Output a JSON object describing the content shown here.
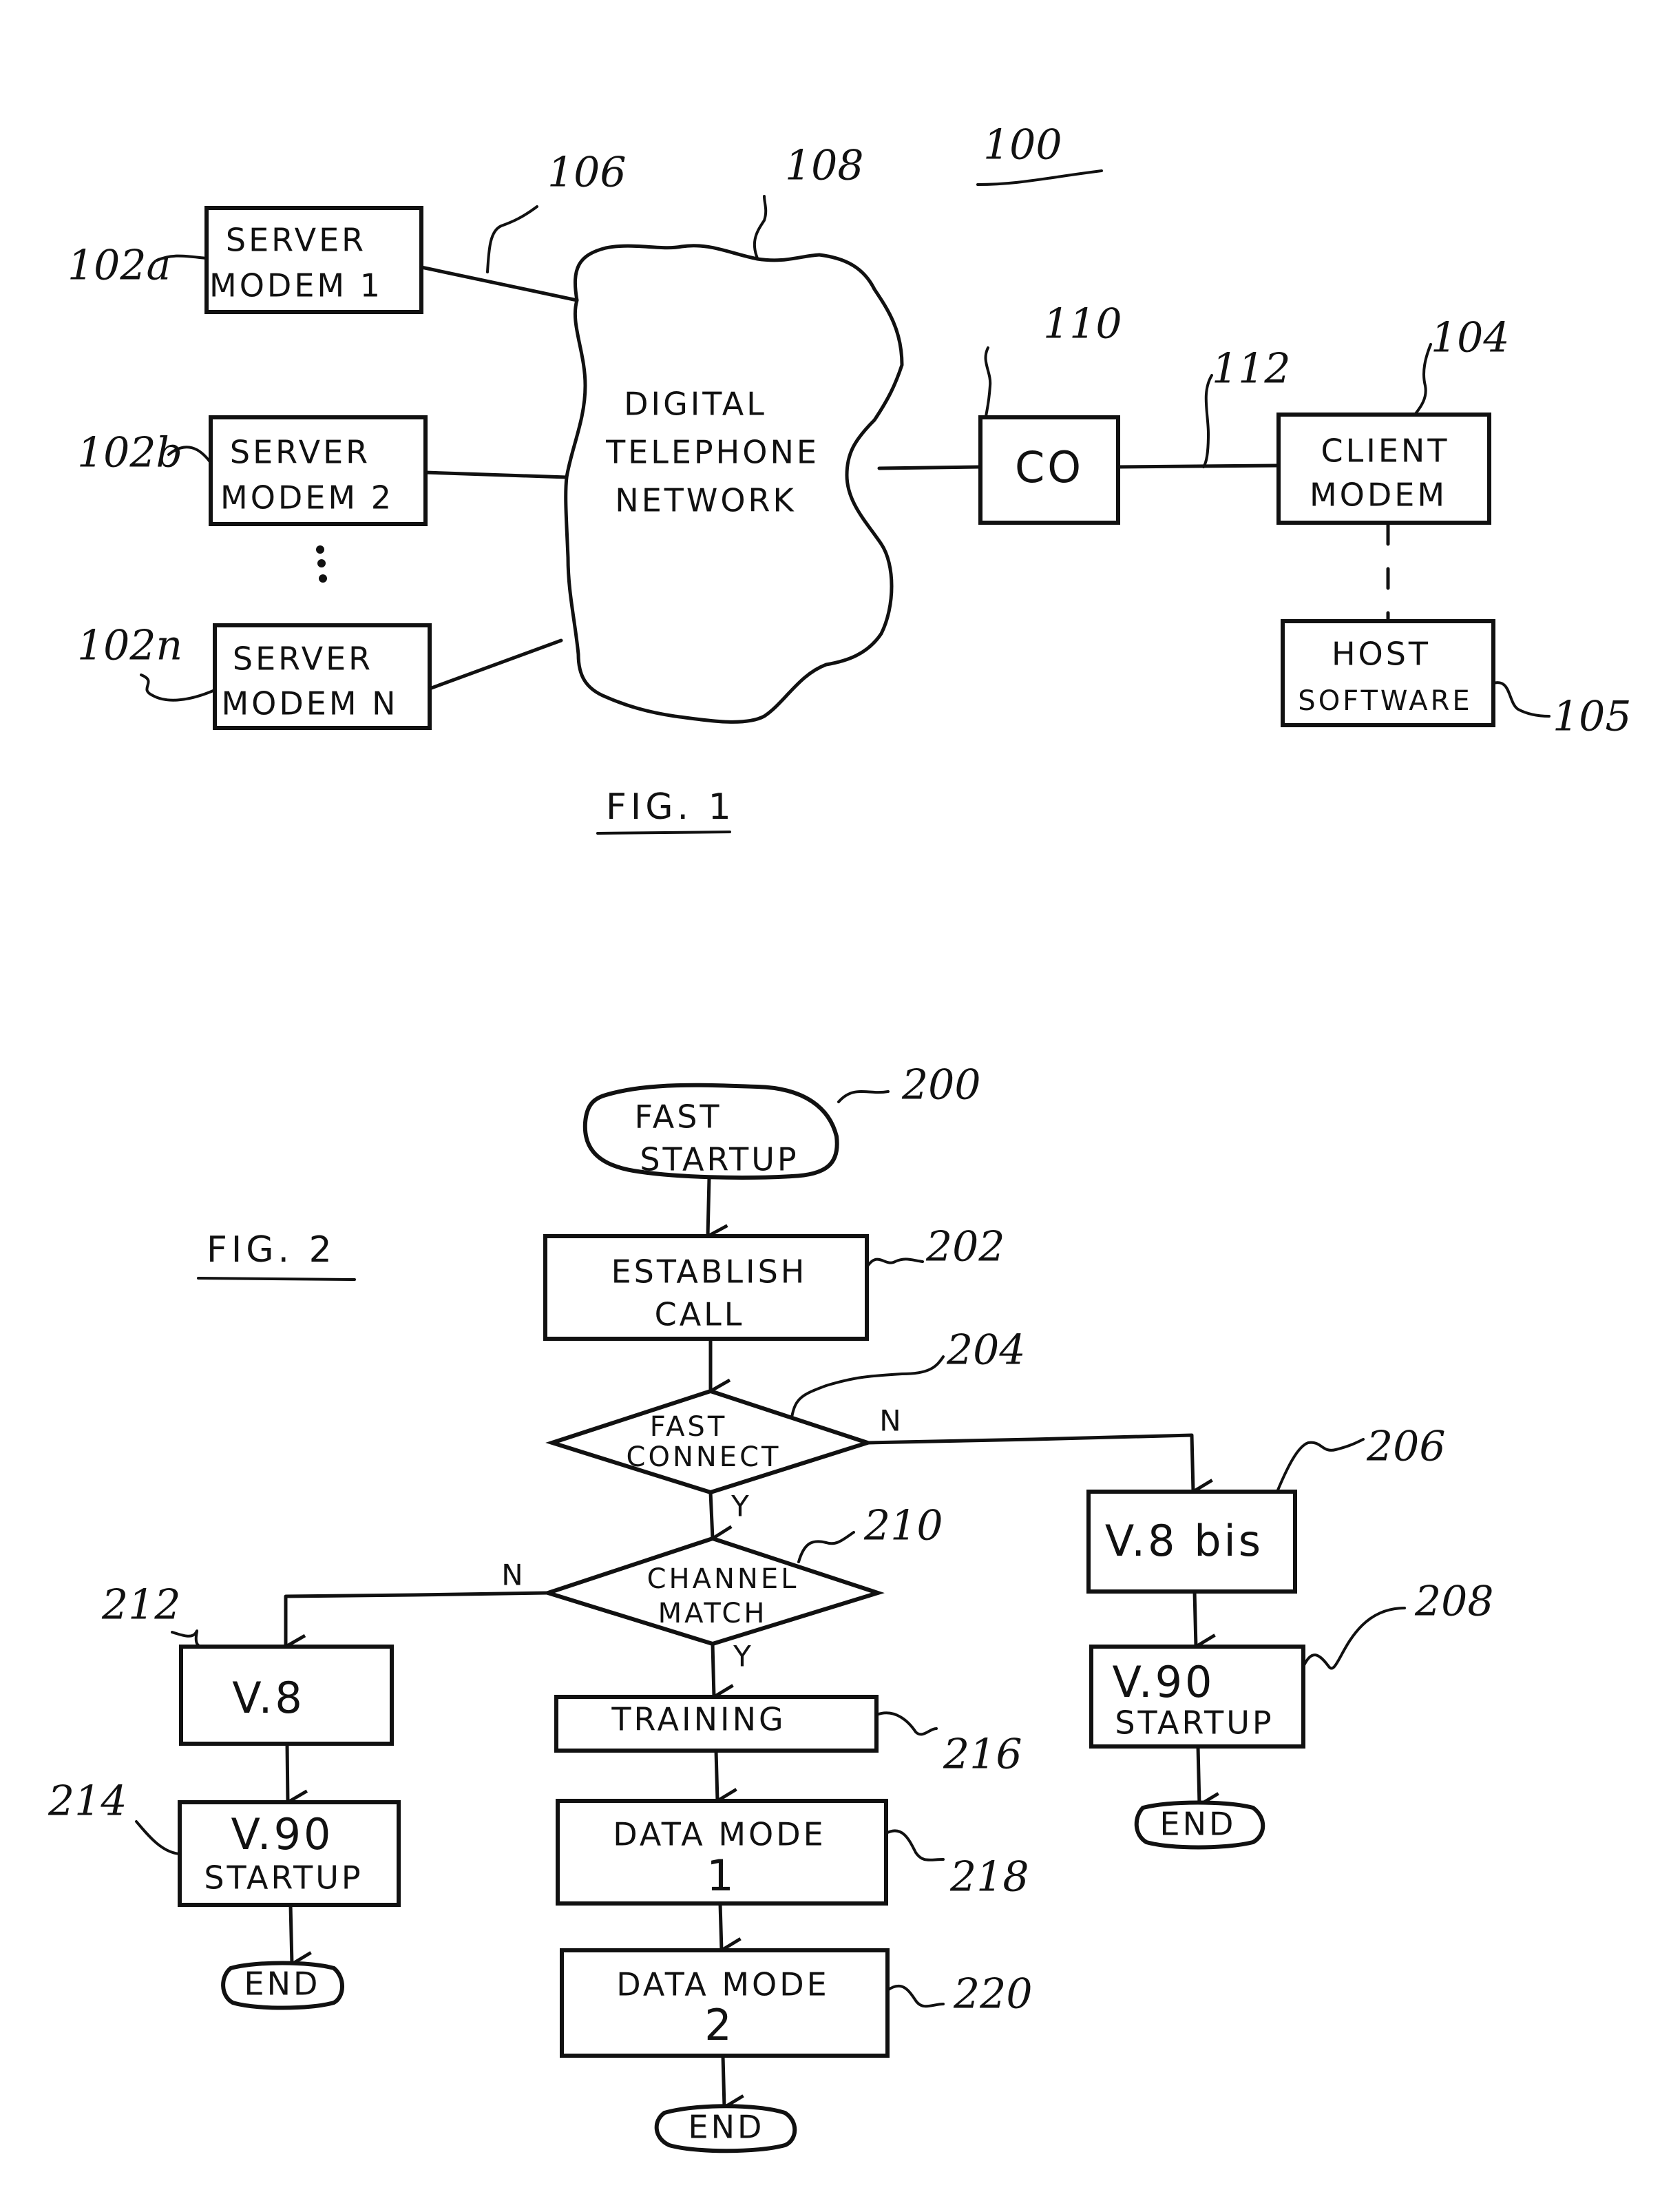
{
  "fig1": {
    "caption": "FIG. 1",
    "system_ref": "100",
    "server_modems": [
      {
        "ref": "102a",
        "line1": "SERVER",
        "line2": "MODEM 1"
      },
      {
        "ref": "102b",
        "line1": "SERVER",
        "line2": "MODEM 2"
      },
      {
        "ref": "102n",
        "line1": "SERVER",
        "line2": "MODEM N"
      }
    ],
    "link_ref": "106",
    "network": {
      "ref": "108",
      "line1": "DIGITAL",
      "line2": "TELEPHONE",
      "line3": "NETWORK"
    },
    "co": {
      "ref": "110",
      "label": "CO"
    },
    "loop_ref": "112",
    "client_modem": {
      "ref": "104",
      "line1": "CLIENT",
      "line2": "MODEM"
    },
    "host_software": {
      "ref": "105",
      "line1": "HOST",
      "line2": "SOFTWARE"
    }
  },
  "fig2": {
    "caption": "FIG. 2",
    "start": {
      "ref": "200",
      "line1": "FAST",
      "line2": "STARTUP"
    },
    "establish_call": {
      "ref": "202",
      "line1": "ESTABLISH",
      "line2": "CALL"
    },
    "fast_connect": {
      "ref": "204",
      "line1": "FAST",
      "line2": "CONNECT",
      "yes": "Y",
      "no": "N"
    },
    "v8bis": {
      "ref": "206",
      "label": "V.8 bis"
    },
    "v90_right": {
      "ref": "208",
      "line1": "V.90",
      "line2": "STARTUP"
    },
    "end_right": {
      "label": "END"
    },
    "channel_match": {
      "ref": "210",
      "line1": "CHANNEL",
      "line2": "MATCH",
      "yes": "Y",
      "no": "N"
    },
    "v8": {
      "ref": "212",
      "label": "V.8"
    },
    "v90_left": {
      "ref": "214",
      "line1": "V.90",
      "line2": "STARTUP"
    },
    "end_left": {
      "label": "END"
    },
    "training": {
      "ref": "216",
      "label": "TRAINING"
    },
    "data_mode_1": {
      "ref": "218",
      "line1": "DATA MODE",
      "line2": "1"
    },
    "data_mode_2": {
      "ref": "220",
      "line1": "DATA MODE",
      "line2": "2"
    },
    "end_bottom": {
      "label": "END"
    }
  }
}
